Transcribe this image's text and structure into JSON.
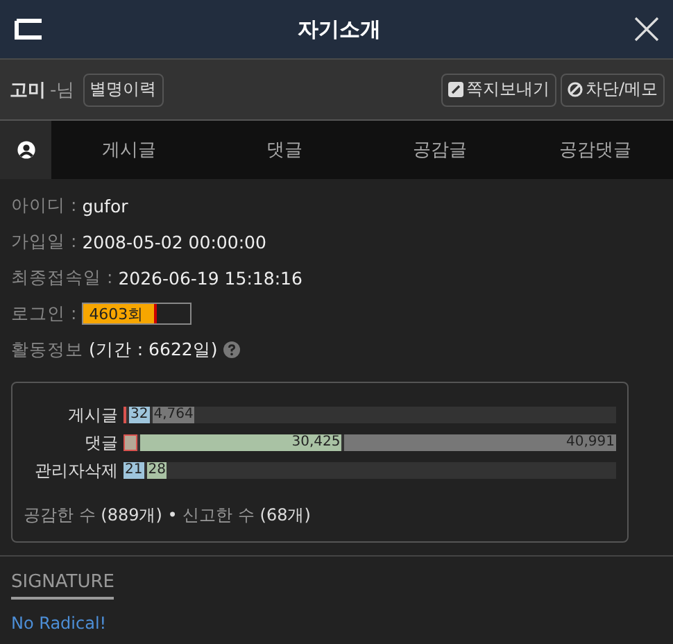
{
  "window": {
    "title": "자기소개"
  },
  "user": {
    "nickname": "고미",
    "suffix": "-님",
    "history_button": "별명이력"
  },
  "actions": [
    "쪽지보내기",
    "차단/메모"
  ],
  "tabs": [
    {
      "kind": "icon",
      "selected": true
    },
    {
      "label": "게시글",
      "selected": false
    },
    {
      "label": "댓글",
      "selected": false
    },
    {
      "label": "공감글",
      "selected": false
    },
    {
      "label": "공감댓글",
      "selected": false
    }
  ],
  "info": [
    {
      "label": "아이디 : ",
      "value": "gufor"
    },
    {
      "label": "가입일 : ",
      "value": "2008-05-02 00:00:00"
    },
    {
      "label": "최종접속일 : ",
      "value": "2026-06-19 15:18:16"
    }
  ],
  "login": {
    "label": "로그인 : ",
    "value": "4603회",
    "level": 0.68
  },
  "activity": {
    "label": "활동정보 ",
    "period": "(기간 : 6622일)"
  },
  "stats": [
    {
      "label": "게시글",
      "segments": [
        {
          "kind": "marker",
          "color": "#d9534f"
        },
        {
          "kind": "count",
          "color": "#9ec5dc",
          "text": "32"
        },
        {
          "kind": "count",
          "color": "#777777",
          "text": "4,764"
        }
      ]
    },
    {
      "label": "댓글",
      "segments": [
        {
          "kind": "marker",
          "color": "#b5a896",
          "outline": true
        },
        {
          "kind": "count",
          "color": "#a9c2a4",
          "text": "30,425"
        },
        {
          "kind": "count",
          "color": "#777777",
          "text": "40,991"
        }
      ]
    },
    {
      "label": "관리자삭제",
      "segments": [
        {
          "kind": "count",
          "color": "#9ec5dc",
          "text": "21"
        },
        {
          "kind": "count",
          "color": "#a9c2a4",
          "text": "28"
        }
      ]
    }
  ],
  "summary": [
    {
      "label": "공감한 수 ",
      "value": "(889개)"
    },
    {
      "label": "신고한 수 ",
      "value": "(68개)"
    }
  ],
  "summary_separator": " • ",
  "signature": {
    "heading": "SIGNATURE",
    "text": "No Radical!"
  }
}
